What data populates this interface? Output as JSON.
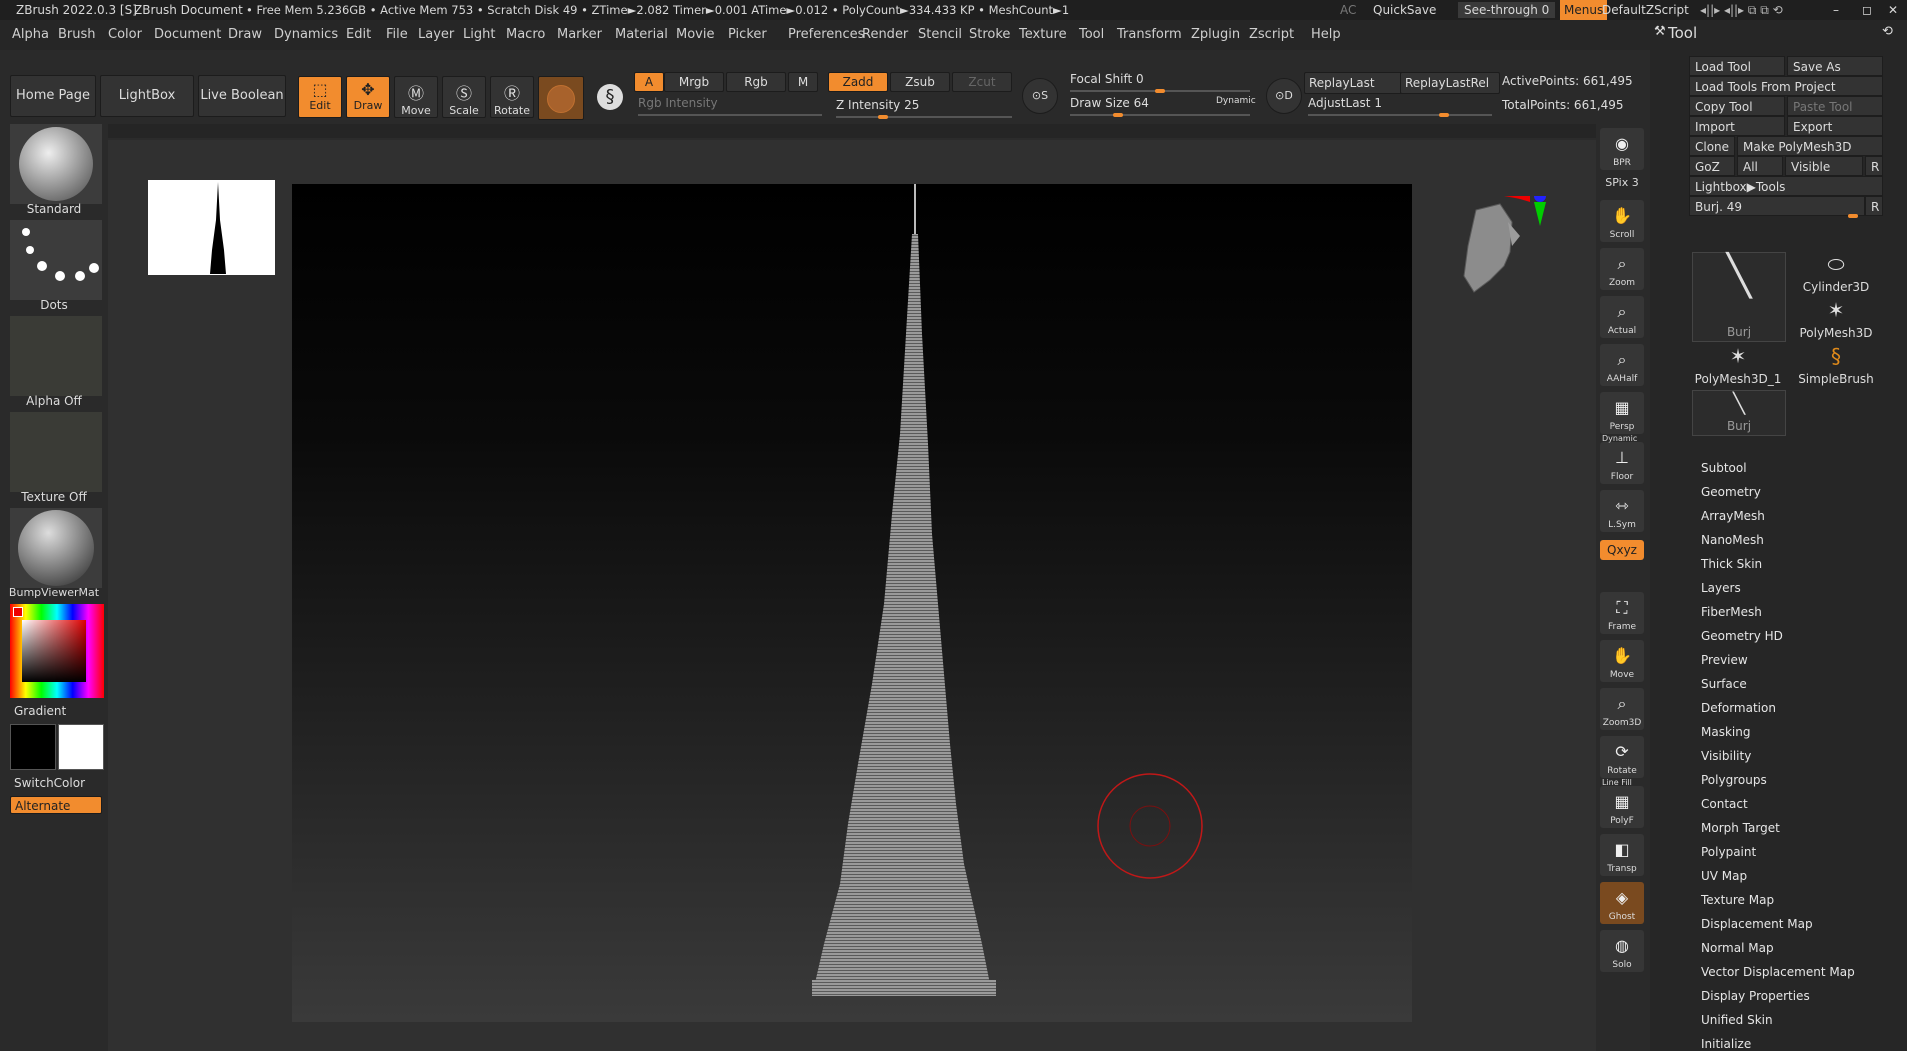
{
  "titlebar": {
    "app": "ZBrush 2022.0.3 [S]",
    "doc": "ZBrush Document",
    "stats": "• Free Mem 5.236GB • Active Mem 753 • Scratch Disk 49 • ZTime►2.082 Timer►0.001 ATime►0.012 • PolyCount►334.433 KP • MeshCount►1",
    "ac": "AC",
    "quicksave": "QuickSave",
    "seethrough": "See-through  0",
    "menus": "Menus",
    "script": "DefaultZScript"
  },
  "menubar": [
    "Alpha",
    "Brush",
    "Color",
    "Document",
    "Draw",
    "Dynamics",
    "Edit",
    "File",
    "Layer",
    "Light",
    "Macro",
    "Marker",
    "Material",
    "Movie",
    "Picker",
    "Preferences",
    "Render",
    "Stencil",
    "Stroke",
    "Texture",
    "Tool",
    "Transform",
    "Zplugin",
    "Zscript",
    "Help"
  ],
  "toolbar": {
    "home": "Home Page",
    "lightbox": "LightBox",
    "liveboolean": "Live Boolean",
    "edit": "Edit",
    "draw": "Draw",
    "move": "Move",
    "scale": "Scale",
    "rotate": "Rotate",
    "a": "A",
    "mrgb": "Mrgb",
    "rgb": "Rgb",
    "m": "M",
    "zadd": "Zadd",
    "zsub": "Zsub",
    "zcut": "Zcut",
    "rgb_intensity": "Rgb Intensity",
    "z_intensity": "Z Intensity 25",
    "focal_shift": "Focal Shift 0",
    "draw_size": "Draw Size 64",
    "dynamic": "Dynamic",
    "replaylast": "ReplayLast",
    "replaylastrel": "ReplayLastRel",
    "adjustlast": "AdjustLast 1",
    "activepoints": "ActivePoints: 661,495",
    "totalpoints": "TotalPoints: 661,495",
    "z_intensity_level": 0.25,
    "focal_shift_level": 0.5,
    "draw_size_level": 0.25,
    "adjustlast_level": 0.75
  },
  "leftshelf": {
    "brush": "Standard",
    "stroke": "Dots",
    "alpha": "Alpha Off",
    "texture": "Texture Off",
    "material": "BumpViewerMat",
    "gradient": "Gradient",
    "switchcolor": "SwitchColor",
    "alternate": "Alternate"
  },
  "rightshelf": {
    "bpr": "BPR",
    "spix": "SPix 3",
    "scroll": "Scroll",
    "zoom": "Zoom",
    "actual": "Actual",
    "aahalf": "AAHalf",
    "dynamic": "Dynamic",
    "persp": "Persp",
    "floor": "Floor",
    "lsym": "L.Sym",
    "qxyz": "Qxyz",
    "frame": "Frame",
    "move": "Move",
    "zoom3d": "Zoom3D",
    "rotate": "Rotate",
    "linefill": "Line Fill",
    "polyf": "PolyF",
    "transp": "Transp",
    "ghost": "Ghost",
    "solo": "Solo"
  },
  "toolpanel": {
    "title": "Tool",
    "load_tool": "Load Tool",
    "save_as": "Save As",
    "load_from_project": "Load Tools From Project",
    "copy_tool": "Copy Tool",
    "paste_tool": "Paste Tool",
    "import": "Import",
    "export": "Export",
    "clone": "Clone",
    "make_polymesh": "Make PolyMesh3D",
    "goz": "GoZ",
    "all": "All",
    "visible": "Visible",
    "r": "R",
    "lightbox_tools": "Lightbox▶Tools",
    "burj_slider": "Burj. 49",
    "burj_level": 0.96,
    "thumbs": [
      "Burj",
      "Cylinder3D",
      "PolyMesh3D",
      "PolyMesh3D_1",
      "SimpleBrush",
      "Burj"
    ],
    "sections": [
      "Subtool",
      "Geometry",
      "ArrayMesh",
      "NanoMesh",
      "Thick Skin",
      "Layers",
      "FiberMesh",
      "Geometry HD",
      "Preview",
      "Surface",
      "Deformation",
      "Masking",
      "Visibility",
      "Polygroups",
      "Contact",
      "Morph Target",
      "Polypaint",
      "UV Map",
      "Texture Map",
      "Displacement Map",
      "Normal Map",
      "Vector Displacement Map",
      "Display Properties",
      "Unified Skin",
      "Initialize"
    ]
  },
  "colors": {
    "accent": "#f28c2e",
    "background": "#2b2b2b"
  }
}
